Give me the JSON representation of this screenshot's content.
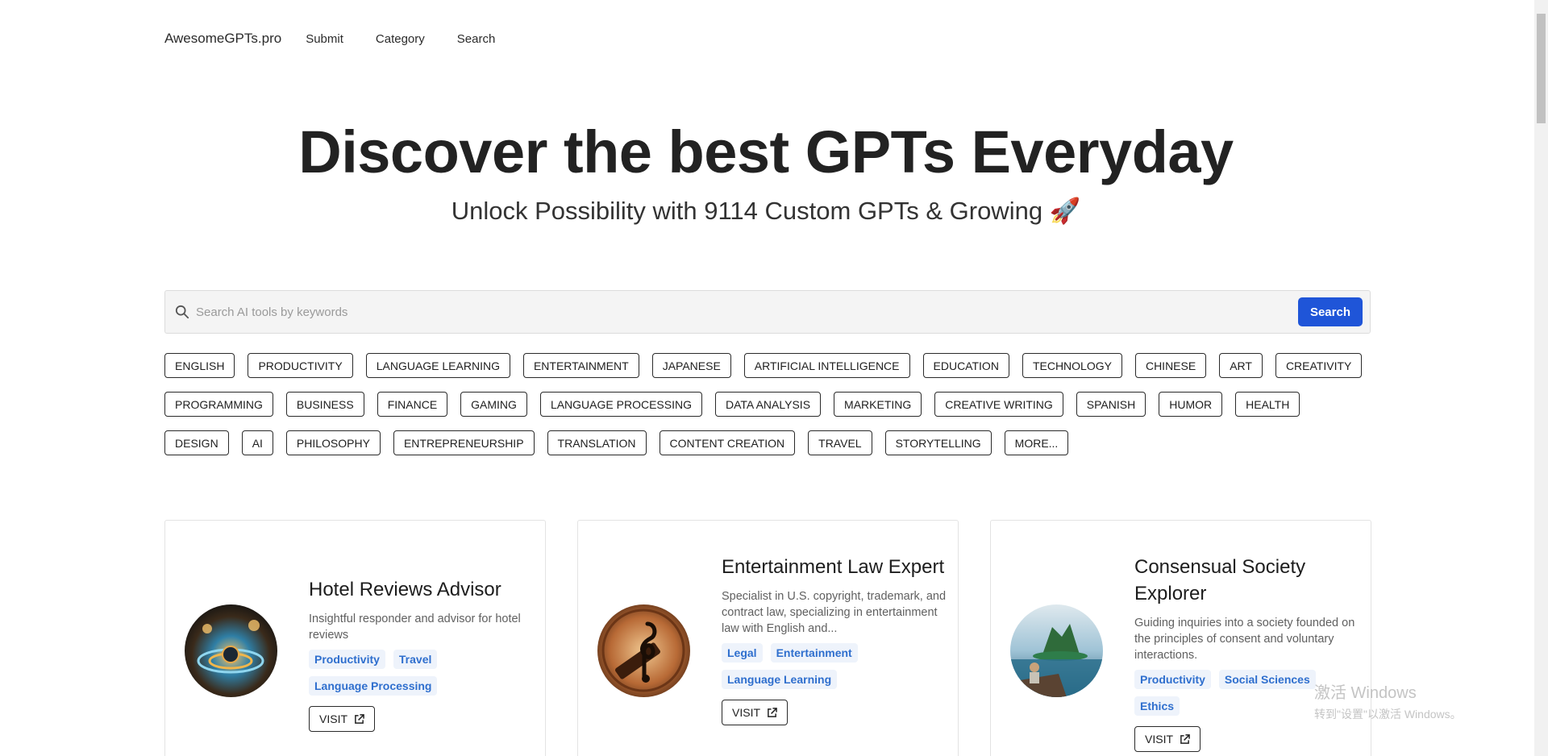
{
  "nav": {
    "brand": "AwesomeGPTs.pro",
    "links": [
      "Submit",
      "Category",
      "Search"
    ]
  },
  "hero": {
    "title": "Discover the best GPTs Everyday",
    "subtitle": "Unlock Possibility with 9114 Custom GPTs & Growing 🚀"
  },
  "search": {
    "placeholder": "Search AI tools by keywords",
    "value": "",
    "button_label": "Search"
  },
  "tags": {
    "row1": [
      "ENGLISH",
      "PRODUCTIVITY",
      "LANGUAGE LEARNING",
      "ENTERTAINMENT",
      "JAPANESE",
      "ARTIFICIAL INTELLIGENCE",
      "EDUCATION",
      "TECHNOLOGY",
      "CHINESE",
      "ART",
      "CREATIVITY"
    ],
    "row2": [
      "PROGRAMMING",
      "BUSINESS",
      "FINANCE",
      "GAMING",
      "LANGUAGE PROCESSING",
      "DATA ANALYSIS",
      "MARKETING",
      "CREATIVE WRITING",
      "SPANISH",
      "HUMOR",
      "HEALTH"
    ],
    "row3": [
      "DESIGN",
      "AI",
      "PHILOSOPHY",
      "ENTREPRENEURSHIP",
      "TRANSLATION",
      "CONTENT CREATION",
      "TRAVEL",
      "STORYTELLING",
      "MORE..."
    ]
  },
  "cards": [
    {
      "title": "Hotel Reviews Advisor",
      "description": "Insightful responder and advisor for hotel reviews",
      "chips": [
        "Productivity",
        "Travel",
        "Language Processing"
      ],
      "visit_label": "VISIT"
    },
    {
      "title": "Entertainment Law Expert",
      "description": "Specialist in U.S. copyright, trademark, and contract law, specializing in entertainment law with English and...",
      "chips": [
        "Legal",
        "Entertainment",
        "Language Learning"
      ],
      "visit_label": "VISIT"
    },
    {
      "title": "Consensual Society Explorer",
      "description": "Guiding inquiries into a society founded on the principles of consent and voluntary interactions.",
      "chips": [
        "Productivity",
        "Social Sciences",
        "Ethics"
      ],
      "visit_label": "VISIT"
    }
  ],
  "watermark": {
    "line1": "激活 Windows",
    "line2": "转到\"设置\"以激活 Windows。"
  },
  "colors": {
    "accent": "#1f55d8",
    "chip_bg": "#eef3fb",
    "chip_text": "#2f6fce"
  }
}
